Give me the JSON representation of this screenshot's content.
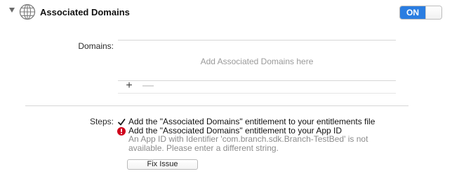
{
  "capability": {
    "title": "Associated Domains",
    "icon": "globe-icon",
    "disclosure_icon": "disclosure-triangle-icon",
    "toggle_label": "ON",
    "toggle_color": "#2a7de1"
  },
  "domains": {
    "label": "Domains:",
    "placeholder": "Add Associated Domains here",
    "add_symbol": "+",
    "remove_symbol": "—"
  },
  "steps": {
    "label": "Steps:",
    "items": [
      {
        "status": "check-icon",
        "text": "Add the \"Associated Domains\" entitlement to your entitlements file"
      },
      {
        "status": "error-icon",
        "status_color": "#d0021b",
        "text": "Add the \"Associated Domains\" entitlement to your App ID",
        "detail": "An App ID with Identifier 'com.branch.sdk.Branch-TestBed' is not available. Please enter a different string."
      }
    ],
    "fix_button_label": "Fix Issue"
  }
}
